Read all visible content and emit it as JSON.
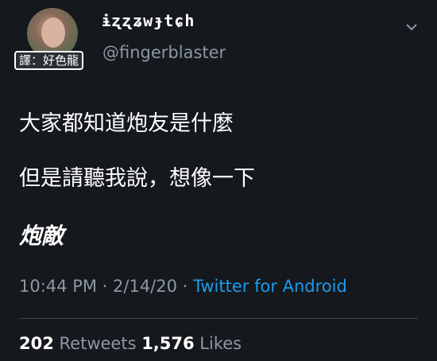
{
  "author": {
    "display_name": "ɨʐʐʑwɟtɕh",
    "handle": "@fingerblaster"
  },
  "translator_tag": "譯：好色龍",
  "tweet": {
    "lines": [
      "大家都知道炮友是什麼",
      "但是請聽我說，想像一下",
      "炮敵"
    ]
  },
  "meta": {
    "time": "10:44 PM",
    "sep1": " · ",
    "date": "2/14/20",
    "sep2": " · ",
    "source": "Twitter for Android"
  },
  "stats": {
    "retweets_count": "202",
    "retweets_label": " Retweets ",
    "likes_count": "1,576",
    "likes_label": " Likes"
  },
  "colors": {
    "background": "#15181c",
    "text": "#ffffff",
    "secondary": "#8b98a5",
    "link": "#1d9bf0"
  },
  "icons": {
    "menu": "chevron-down-icon"
  }
}
